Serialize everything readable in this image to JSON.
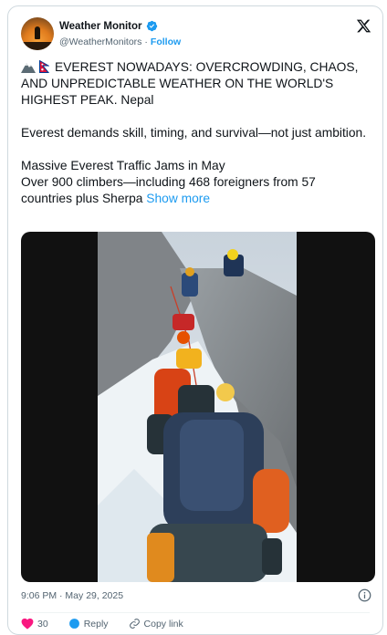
{
  "post": {
    "author_name": "Weather Monitor",
    "handle": "@WeatherMonitors",
    "separator": "·",
    "follow_label": "Follow",
    "headline": "EVEREST NOWADAYS: OVERCROWDING, CHAOS, AND UNPREDICTABLE WEATHER ON THE WORLD'S HIGHEST PEAK. Nepal",
    "line2": "Everest demands skill, timing, and survival—not just ambition.",
    "line3": "Massive Everest Traffic Jams in May",
    "line4": "Over 900 climbers—including 468 foreigners from 57 countries plus Sherpa",
    "show_more": "Show more",
    "timestamp": "9:06 PM · May 29, 2025",
    "likes": "30",
    "reply_label": "Reply",
    "copy_label": "Copy link"
  },
  "colors": {
    "link": "#1d9bf0",
    "muted": "#536471",
    "like": "#f91880"
  },
  "icons": [
    "verified-badge-icon",
    "x-logo-icon",
    "mountain-emoji-icon",
    "nepal-flag-icon",
    "info-icon",
    "heart-icon",
    "reply-icon",
    "link-icon"
  ]
}
